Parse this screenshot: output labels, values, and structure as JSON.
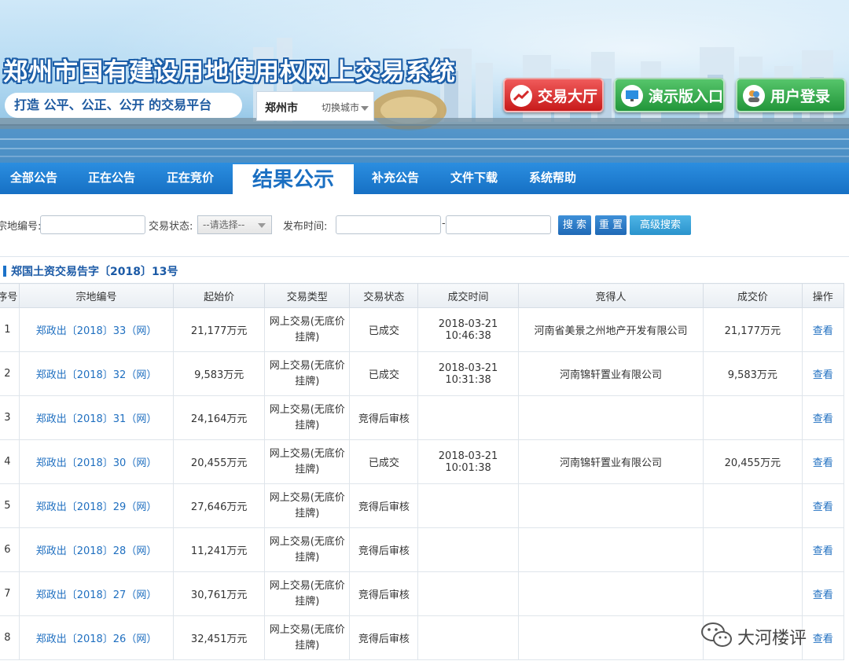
{
  "header": {
    "site_title": "郑州市国有建设用地使用权网上交易系统",
    "slogan": "打造 公平、公正、公开 的交易平台",
    "city": "郑州市",
    "switch_city": "切换城市",
    "buttons": {
      "trading_hall": "交易大厅",
      "demo_entry": "演示版入口",
      "user_login": "用户登录"
    }
  },
  "nav": {
    "items": [
      "全部公告",
      "正在公告",
      "正在竞价",
      "结果公示",
      "补充公告",
      "文件下载",
      "系统帮助"
    ],
    "active": "结果公示"
  },
  "search": {
    "lot_label": "宗地编号:",
    "lot_value": "",
    "status_label": "交易状态:",
    "status_selected": "--请选择--",
    "date_label": "发布时间:",
    "date_from": "",
    "date_separator": "-",
    "date_to": "",
    "search_button": "搜 索",
    "reset_button": "重 置",
    "advanced_button": "高级搜索"
  },
  "announcement": {
    "title": "郑国土资交易告字〔2018〕13号"
  },
  "table": {
    "headers": [
      "序号",
      "宗地编号",
      "起始价",
      "交易类型",
      "交易状态",
      "成交时间",
      "竞得人",
      "成交价",
      "操作"
    ],
    "rows": [
      {
        "no": "1",
        "lot": "郑政出〔2018〕33（网）",
        "start_price": "21,177万元",
        "type_line1": "网上交易(无底价",
        "type_line2": "挂牌)",
        "status": "已成交",
        "time": "2018-03-21 10:46:38",
        "winner": "河南省美景之州地产开发有限公司",
        "final_price": "21,177万元",
        "action": "查看"
      },
      {
        "no": "2",
        "lot": "郑政出〔2018〕32（网）",
        "start_price": "9,583万元",
        "type_line1": "网上交易(无底价",
        "type_line2": "挂牌)",
        "status": "已成交",
        "time": "2018-03-21 10:31:38",
        "winner": "河南锦轩置业有限公司",
        "final_price": "9,583万元",
        "action": "查看"
      },
      {
        "no": "3",
        "lot": "郑政出〔2018〕31（网）",
        "start_price": "24,164万元",
        "type_line1": "网上交易(无底价",
        "type_line2": "挂牌)",
        "status": "竞得后审核",
        "time": "",
        "winner": "",
        "final_price": "",
        "action": "查看"
      },
      {
        "no": "4",
        "lot": "郑政出〔2018〕30（网）",
        "start_price": "20,455万元",
        "type_line1": "网上交易(无底价",
        "type_line2": "挂牌)",
        "status": "已成交",
        "time": "2018-03-21 10:01:38",
        "winner": "河南锦轩置业有限公司",
        "final_price": "20,455万元",
        "action": "查看"
      },
      {
        "no": "5",
        "lot": "郑政出〔2018〕29（网）",
        "start_price": "27,646万元",
        "type_line1": "网上交易(无底价",
        "type_line2": "挂牌)",
        "status": "竞得后审核",
        "time": "",
        "winner": "",
        "final_price": "",
        "action": "查看"
      },
      {
        "no": "6",
        "lot": "郑政出〔2018〕28（网）",
        "start_price": "11,241万元",
        "type_line1": "网上交易(无底价",
        "type_line2": "挂牌)",
        "status": "竞得后审核",
        "time": "",
        "winner": "",
        "final_price": "",
        "action": "查看"
      },
      {
        "no": "7",
        "lot": "郑政出〔2018〕27（网）",
        "start_price": "30,761万元",
        "type_line1": "网上交易(无底价",
        "type_line2": "挂牌)",
        "status": "竞得后审核",
        "time": "",
        "winner": "",
        "final_price": "",
        "action": "查看"
      },
      {
        "no": "8",
        "lot": "郑政出〔2018〕26（网）",
        "start_price": "32,451万元",
        "type_line1": "网上交易(无底价",
        "type_line2": "挂牌)",
        "status": "竞得后审核",
        "time": "",
        "winner": "",
        "final_price": "",
        "action": "查看"
      }
    ]
  },
  "watermark": {
    "text": "大河楼评"
  },
  "colors": {
    "nav_blue": "#1670c4",
    "link_blue": "#1f6fc0",
    "hall_red": "#c81a1a",
    "green": "#22963a"
  }
}
